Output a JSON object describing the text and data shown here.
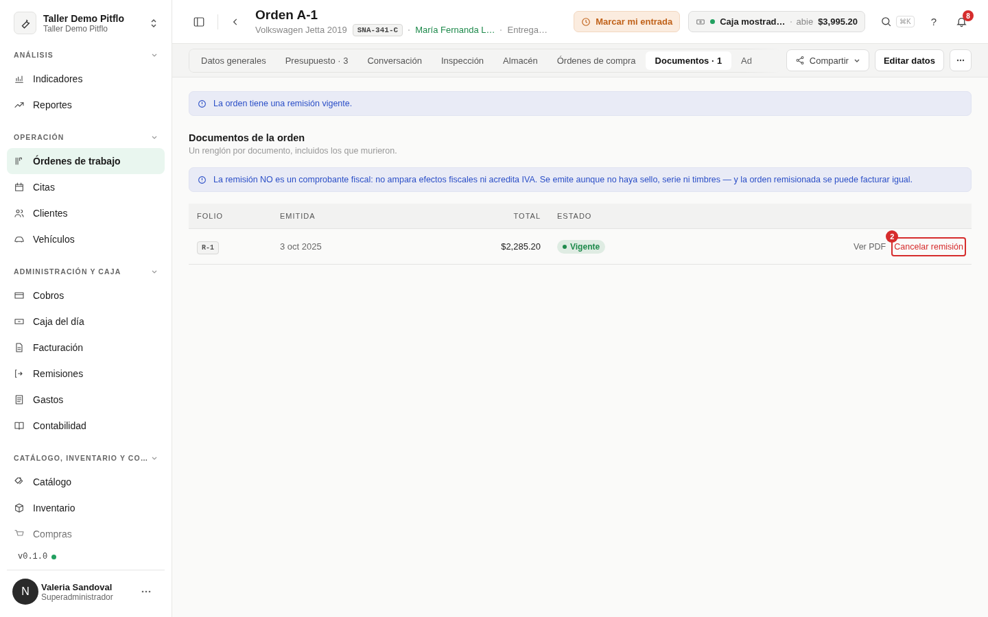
{
  "workspace": {
    "name": "Taller Demo Pitflo",
    "subtitle": "Taller Demo Pitflo"
  },
  "sidebar": {
    "groups": [
      {
        "title": "ANÁLISIS",
        "expanded": true,
        "items": [
          {
            "label": "Indicadores",
            "selected": false
          },
          {
            "label": "Reportes",
            "selected": false
          }
        ]
      },
      {
        "title": "OPERACIÓN",
        "expanded": true,
        "items": [
          {
            "label": "Órdenes de trabajo",
            "selected": true
          },
          {
            "label": "Citas",
            "selected": false
          },
          {
            "label": "Clientes",
            "selected": false
          },
          {
            "label": "Vehículos",
            "selected": false
          }
        ]
      },
      {
        "title": "ADMINISTRACIÓN Y CAJA",
        "expanded": true,
        "items": [
          {
            "label": "Cobros",
            "selected": false
          },
          {
            "label": "Caja del día",
            "selected": false
          },
          {
            "label": "Facturación",
            "selected": false
          },
          {
            "label": "Remisiones",
            "selected": false
          },
          {
            "label": "Gastos",
            "selected": false
          },
          {
            "label": "Contabilidad",
            "selected": false
          }
        ]
      },
      {
        "title": "CATÁLOGO, INVENTARIO Y CO…",
        "expanded": true,
        "items": [
          {
            "label": "Catálogo",
            "selected": false
          },
          {
            "label": "Inventario",
            "selected": false
          },
          {
            "label": "Compras",
            "selected": false
          }
        ]
      }
    ],
    "version": "v0.1.0",
    "status": {
      "color": "#22a060"
    },
    "user": {
      "initial": "N",
      "name": "Valeria Sandoval",
      "role": "Superadministrador"
    }
  },
  "header": {
    "title": "Orden A-1",
    "vehicle": "Volkswagen Jetta 2019",
    "plate": "SNA-341-C",
    "customer": "María Fernanda L…",
    "status": "Entrega…",
    "clock_in": "Marcar mi entrada",
    "register": {
      "name": "Caja mostrad…",
      "state": "abie",
      "amount": "$3,995.20",
      "color": "#22a060"
    },
    "shortcut": "⌘K",
    "help": "?",
    "notifications": "8"
  },
  "tabs": [
    {
      "label": "Datos generales",
      "selected": false
    },
    {
      "label": "Presupuesto · 3",
      "selected": false
    },
    {
      "label": "Conversación",
      "selected": false
    },
    {
      "label": "Inspección",
      "selected": false
    },
    {
      "label": "Almacén",
      "selected": false
    },
    {
      "label": "Órdenes de compra",
      "selected": false
    },
    {
      "label": "Documentos · 1",
      "selected": true
    },
    {
      "label": "Ad",
      "selected": false
    }
  ],
  "actions": {
    "share": "Compartir",
    "edit": "Editar datos"
  },
  "notice": "La orden tiene una remisión vigente.",
  "section": {
    "title": "Documentos de la orden",
    "subtitle": "Un renglón por documento, incluidos los que murieron."
  },
  "info": "La remisión NO es un comprobante fiscal: no ampara efectos fiscales ni acredita IVA. Se emite aunque no haya sello, serie ni timbres — y la orden remisionada se puede facturar igual.",
  "table": {
    "columns": [
      "FOLIO",
      "EMITIDA",
      "TOTAL",
      "ESTADO"
    ],
    "rows": [
      {
        "folio": "R-1",
        "issued": "3 oct 2025",
        "total": "$2,285.20",
        "status": "Vigente",
        "color": "#1f8a4c",
        "view": "Ver PDF",
        "cancel": "Cancelar remisión",
        "cancel_badge": "2"
      }
    ]
  }
}
